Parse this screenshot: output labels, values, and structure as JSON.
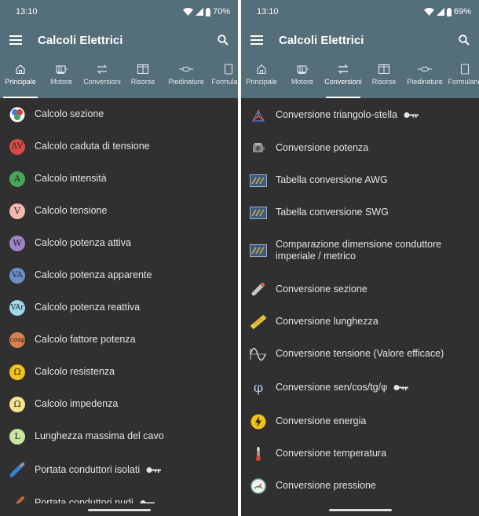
{
  "left": {
    "status": {
      "time": "13:10",
      "battery": "70%"
    },
    "title": "Calcoli Elettrici",
    "tabs": [
      "Principale",
      "Motore",
      "Conversioni",
      "Risorse",
      "Piedinature",
      "Formulario"
    ],
    "items": [
      {
        "label": "Calcolo sezione"
      },
      {
        "label": "Calcolo caduta di tensione",
        "glyph": "ΔV"
      },
      {
        "label": "Calcolo intensità",
        "glyph": "A"
      },
      {
        "label": "Calcolo tensione",
        "glyph": "V"
      },
      {
        "label": "Calcolo potenza attiva",
        "glyph": "W"
      },
      {
        "label": "Calcolo potenza apparente",
        "glyph": "VA"
      },
      {
        "label": "Calcolo potenza reattiva",
        "glyph": "VAr"
      },
      {
        "label": "Calcolo fattore potenza",
        "glyph": "cosφ"
      },
      {
        "label": "Calcolo resistenza",
        "glyph": "Ω"
      },
      {
        "label": "Calcolo impedenza",
        "glyph": "Ω"
      },
      {
        "label": "Lunghezza massima del cavo",
        "glyph": "L"
      },
      {
        "label": "Portata conduttori isolati"
      },
      {
        "label": "Portata conduttori nudi"
      }
    ]
  },
  "right": {
    "status": {
      "time": "13:10",
      "battery": "69%"
    },
    "title": "Calcoli Elettrici",
    "tabs": [
      "Principale",
      "Motore",
      "Conversioni",
      "Risorse",
      "Piedinature",
      "Formulario"
    ],
    "items": [
      {
        "label": "Conversione triangolo-stella"
      },
      {
        "label": "Conversione potenza"
      },
      {
        "label": "Tabella conversione AWG"
      },
      {
        "label": "Tabella conversione SWG"
      },
      {
        "label": "Comparazione dimensione conduttore imperiale / metrico"
      },
      {
        "label": "Conversione sezione"
      },
      {
        "label": "Conversione lunghezza"
      },
      {
        "label": "Conversione tensione (Valore efficace)"
      },
      {
        "label": "Conversione sen/cos/tg/φ",
        "glyph": "φ"
      },
      {
        "label": "Conversione energia"
      },
      {
        "label": "Conversione temperatura"
      },
      {
        "label": "Conversione pressione"
      }
    ]
  },
  "colors": {
    "appbar": "#546e7a",
    "background": "#303030",
    "text": "#e4e4e4"
  }
}
